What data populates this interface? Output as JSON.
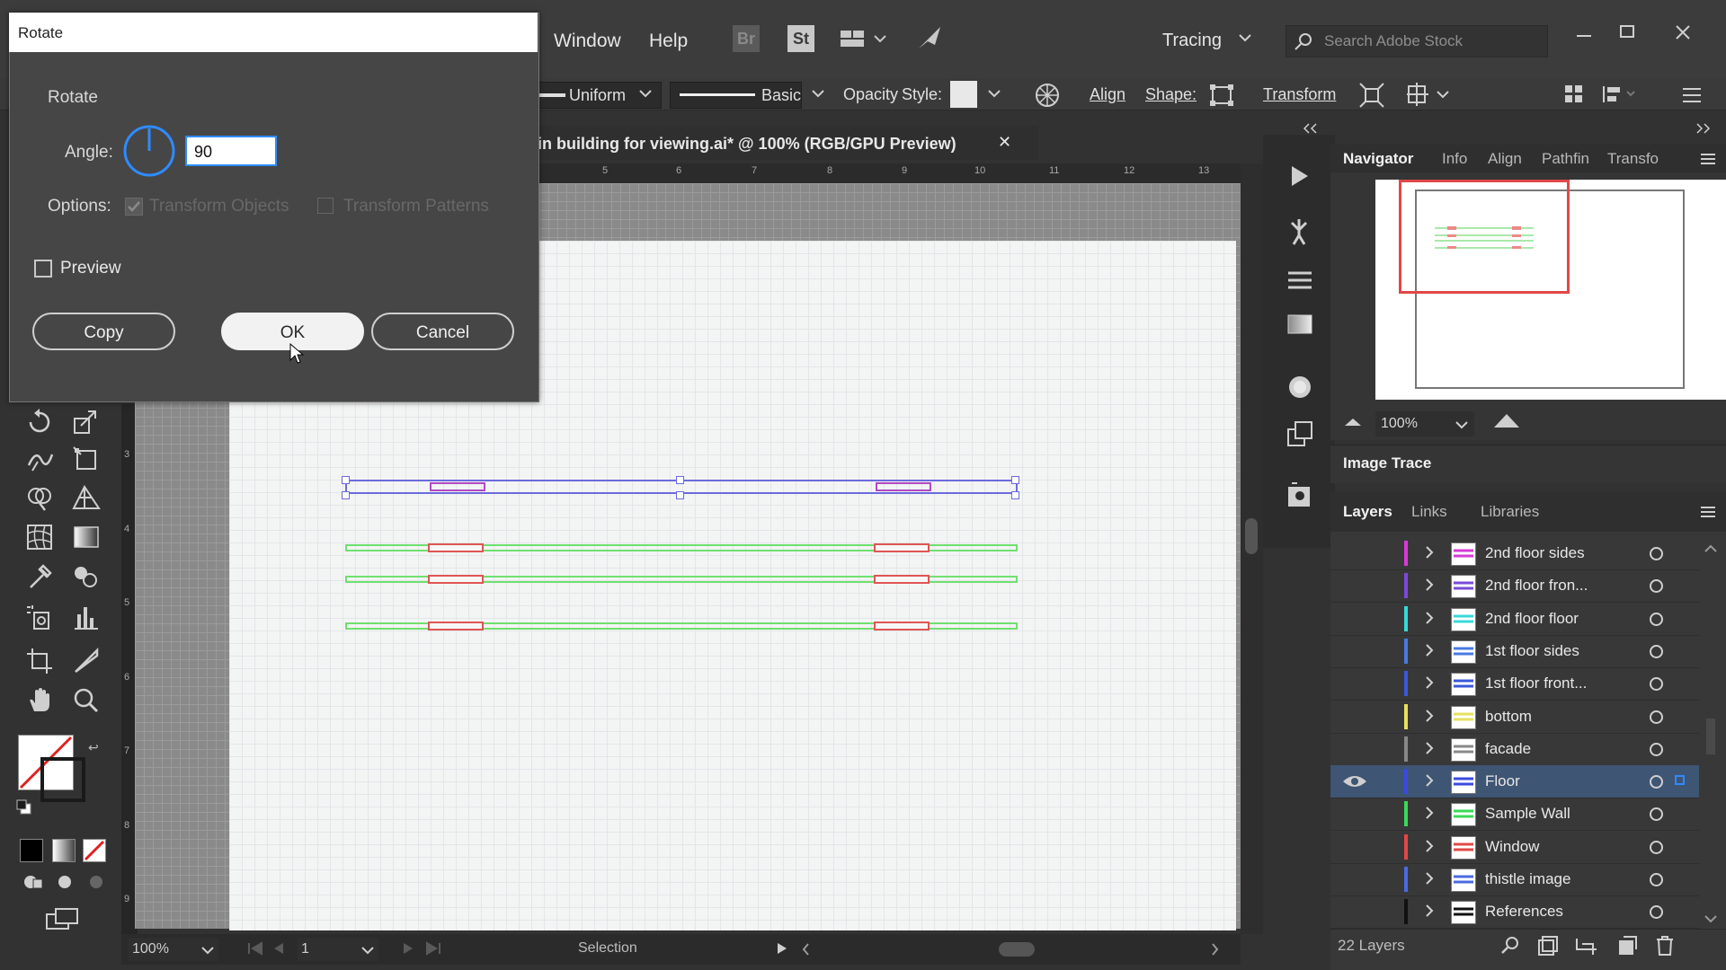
{
  "menubar": {
    "items": [
      "Window",
      "Help"
    ],
    "badge_br": "Br",
    "badge_st": "St",
    "workspace": "Tracing",
    "search_placeholder": "Search Adobe Stock"
  },
  "optionsbar": {
    "stroke_profile": "Uniform",
    "brush": "Basic",
    "opacity_label": "Opacity",
    "style_label": "Style:",
    "align_label": "Align",
    "shape_label": "Shape:",
    "transform_label": "Transform"
  },
  "document": {
    "tab_title": "in building for viewing.ai* @ 100% (RGB/GPU Preview)",
    "close_glyph": "✕",
    "ruler_numbers": [
      "5",
      "6",
      "7",
      "8",
      "9",
      "10",
      "11",
      "12",
      "13"
    ],
    "vertical_ruler_numbers": [
      "3",
      "4",
      "5",
      "6",
      "7",
      "8",
      "9"
    ]
  },
  "dialog": {
    "window_title": "Rotate",
    "section_label": "Rotate",
    "angle_label": "Angle:",
    "angle_value": "90",
    "options_label": "Options:",
    "transform_objects_label": "Transform Objects",
    "transform_patterns_label": "Transform Patterns",
    "preview_label": "Preview",
    "copy_label": "Copy",
    "ok_label": "OK",
    "cancel_label": "Cancel"
  },
  "navigator": {
    "tabs": [
      "Navigator",
      "Info",
      "Align",
      "Pathfin",
      "Transfo"
    ],
    "zoom": "100%"
  },
  "image_trace": {
    "title": "Image Trace"
  },
  "layers": {
    "tabs": [
      "Layers",
      "Links",
      "Libraries"
    ],
    "rows": [
      {
        "name": "2nd floor sides",
        "color": "#d63ad6"
      },
      {
        "name": "2nd floor fron...",
        "color": "#7a4ad8"
      },
      {
        "name": "2nd floor floor",
        "color": "#38d8d8"
      },
      {
        "name": "1st floor sides",
        "color": "#4a7ae0"
      },
      {
        "name": "1st floor front...",
        "color": "#3a58d8"
      },
      {
        "name": "bottom",
        "color": "#e6e060"
      },
      {
        "name": "facade",
        "color": "#888888"
      },
      {
        "name": "Floor",
        "color": "#3a4ae0"
      },
      {
        "name": "Sample Wall",
        "color": "#3ad858"
      },
      {
        "name": "Window",
        "color": "#e04848"
      },
      {
        "name": "thistle image",
        "color": "#4a6ae0"
      },
      {
        "name": "References",
        "color": "#111111"
      }
    ],
    "selected_index": 7,
    "count_label": "22 Layers"
  },
  "statusbar": {
    "zoom": "100%",
    "page": "1",
    "tool": "Selection"
  },
  "colors": {
    "accent_blue": "#2f8bff",
    "selection_row": "#3e5573",
    "path_green": "#6fe06f",
    "path_red": "#e05555",
    "selected_path": "#6b6bdc"
  }
}
